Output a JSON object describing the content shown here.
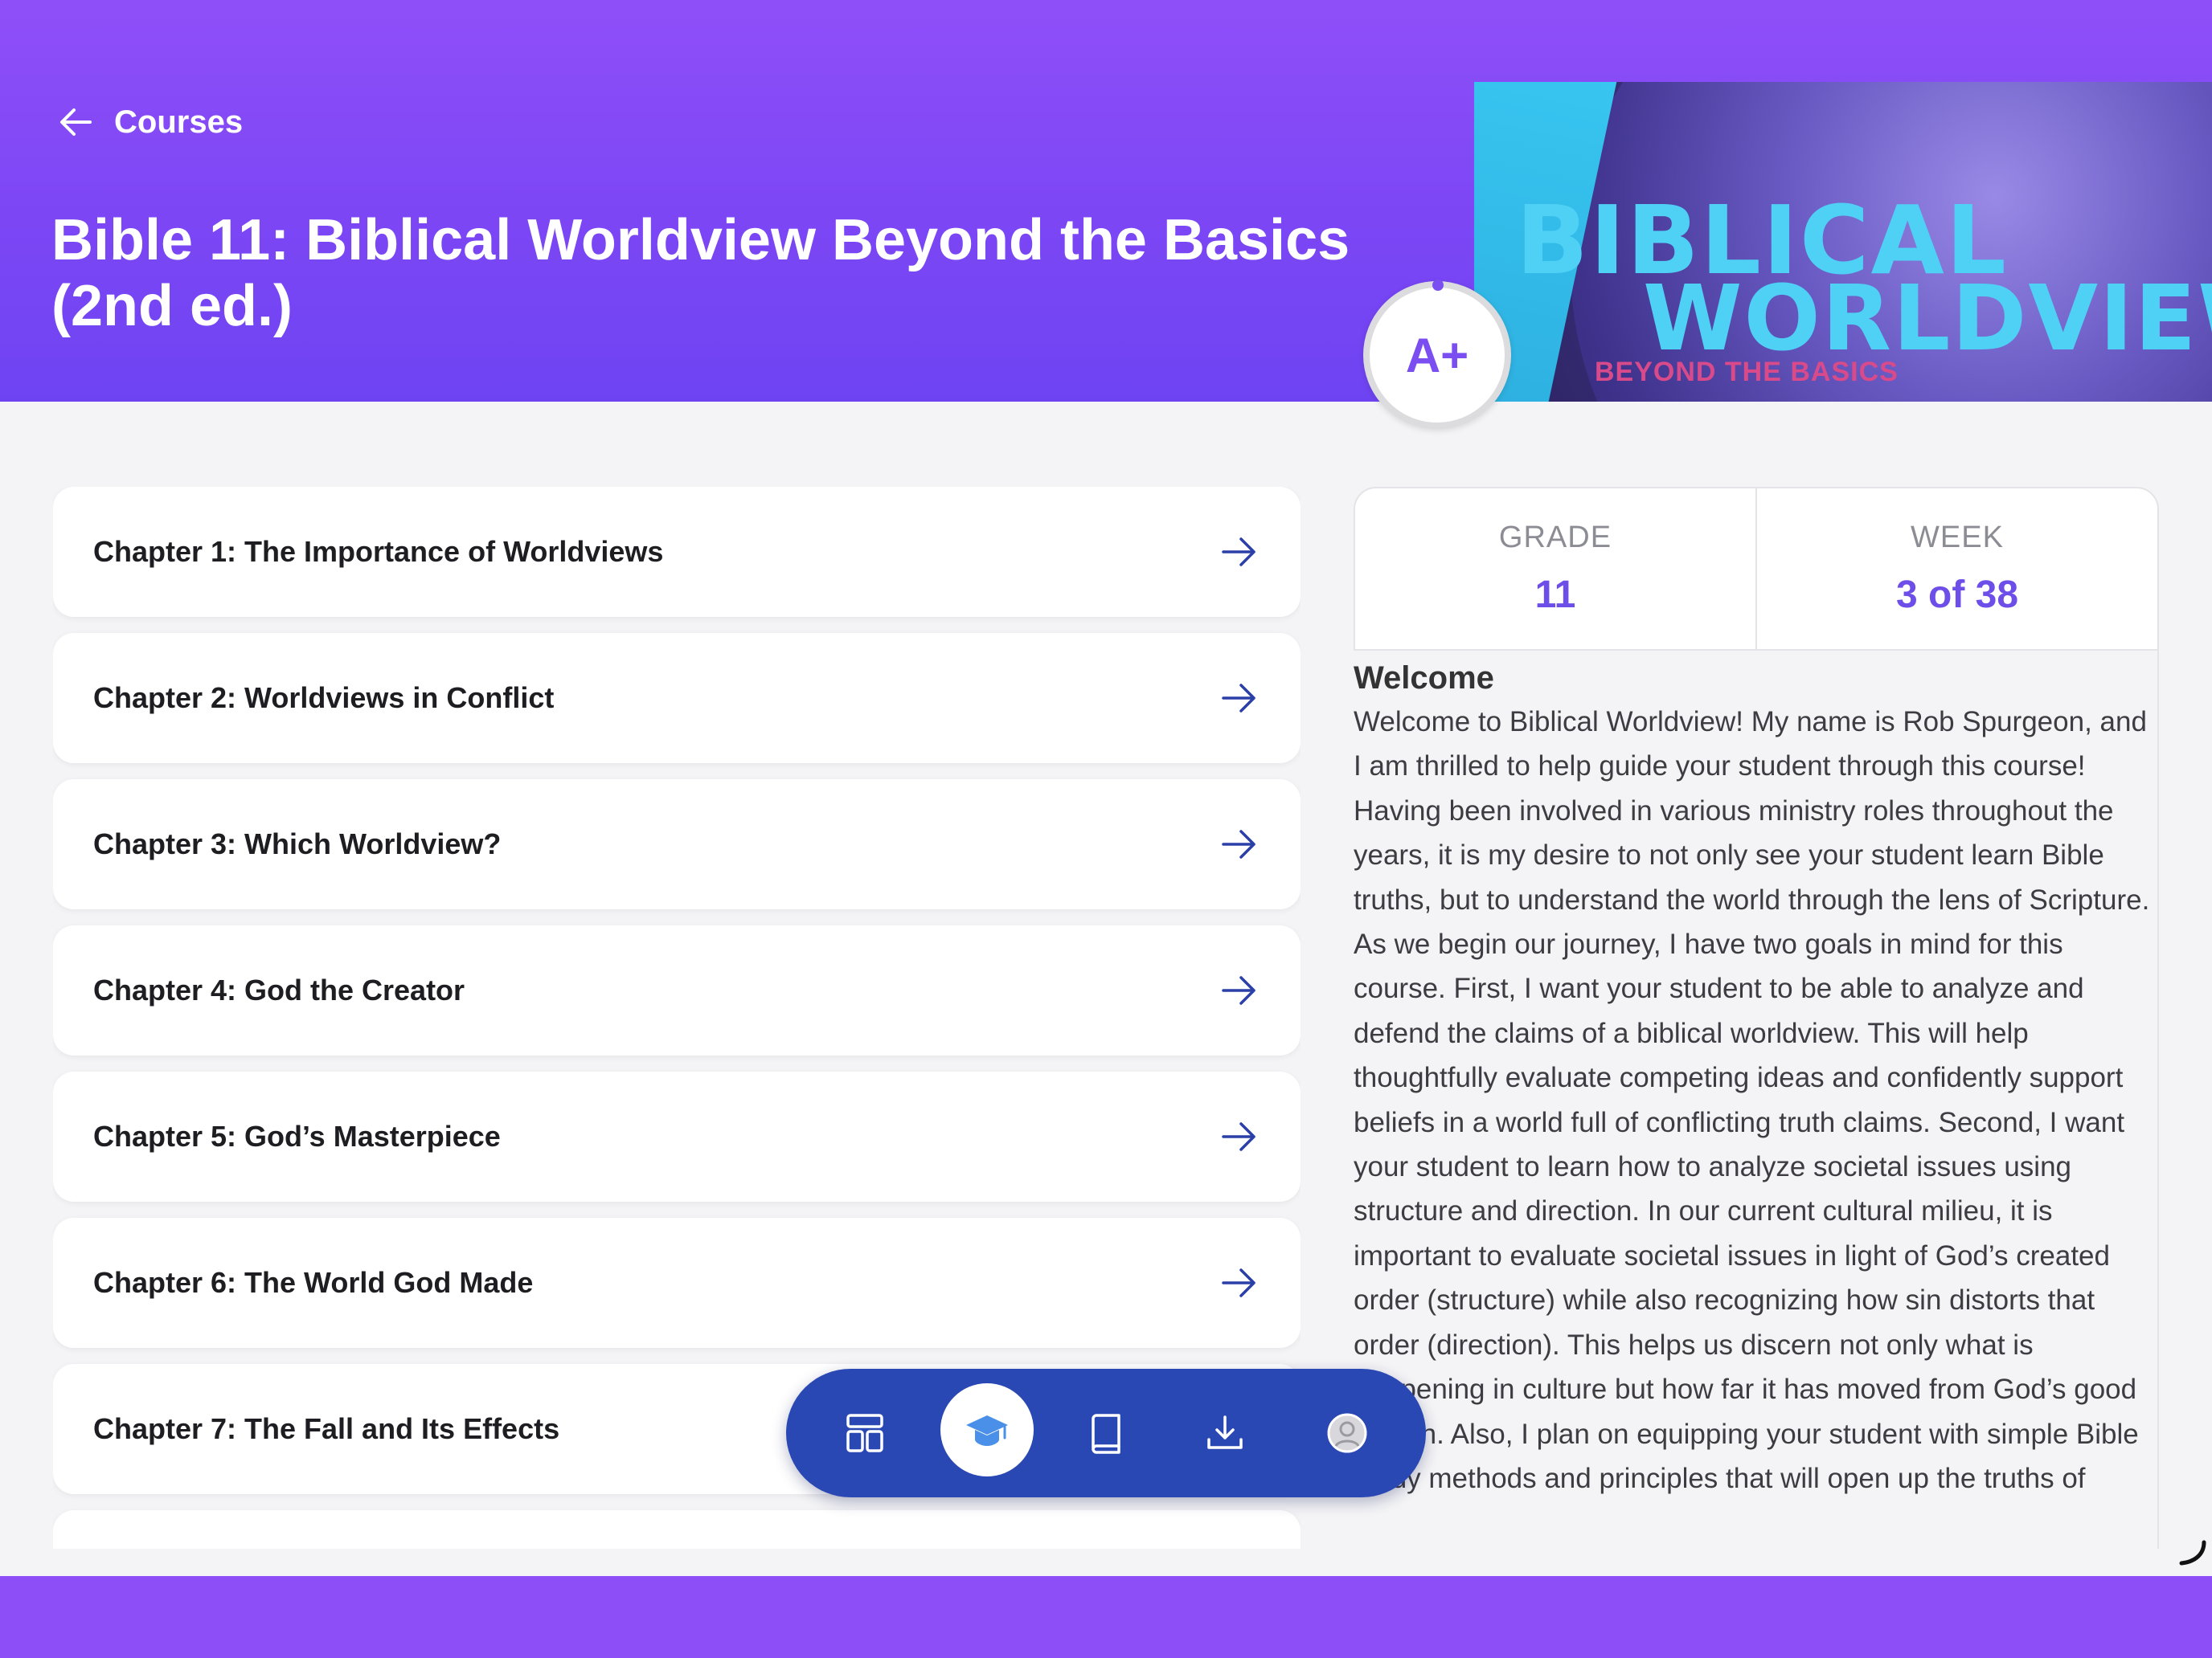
{
  "header": {
    "back_label": "Courses",
    "title": "Bible 11: Biblical Worldview Beyond the Basics (2nd ed.)",
    "banner": {
      "line1": "BIBLICAL",
      "line2": "WORLDVIEW",
      "line3": "BEYOND THE BASICS"
    },
    "grade_badge": "A+"
  },
  "chapters": [
    {
      "label": "Chapter 1: The Importance of Worldviews"
    },
    {
      "label": "Chapter 2: Worldviews in Conflict"
    },
    {
      "label": "Chapter 3: Which Worldview?"
    },
    {
      "label": "Chapter 4: God the Creator"
    },
    {
      "label": "Chapter 5: God’s Masterpiece"
    },
    {
      "label": "Chapter 6: The World God Made"
    },
    {
      "label": "Chapter 7: The Fall and Its Effects"
    },
    {
      "label": ""
    }
  ],
  "stats": {
    "grade_label": "GRADE",
    "grade_value": "11",
    "week_label": "WEEK",
    "week_value": "3 of 38"
  },
  "welcome": {
    "heading": "Welcome",
    "body": "Welcome to Biblical Worldview! My name is Rob Spurgeon, and I am thrilled to help guide your student through this course! Having been involved in various ministry roles throughout the years, it is my desire to not only see your student learn Bible truths, but to understand the world through the lens of Scripture. As we begin our journey, I have two goals in mind for this course. First, I want your student to be able to analyze and defend the claims of a biblical worldview. This will help thoughtfully evaluate competing ideas and confidently support beliefs in a world full of conflicting truth claims. Second, I want your student to learn how to analyze societal issues using structure and direction. In our current cultural milieu, it is important to evaluate societal issues in light of God’s created order (structure) while also recognizing how sin distorts that order (direction). This helps us discern not only what is happening in culture but how far it has moved from God’s good design. Also, I plan on equipping your student with simple Bible study methods and principles that will open up the truths of"
  },
  "bottom_nav": {
    "items": [
      "dashboard-icon",
      "graduation-cap-icon",
      "book-icon",
      "download-icon",
      "profile-icon"
    ],
    "active": "graduation-cap-icon"
  },
  "colors": {
    "header_purple": "#8f4ff8",
    "accent": "#6d4ee8",
    "nav_blue": "#2a48b4",
    "arrow_blue": "#2a3fa8"
  }
}
